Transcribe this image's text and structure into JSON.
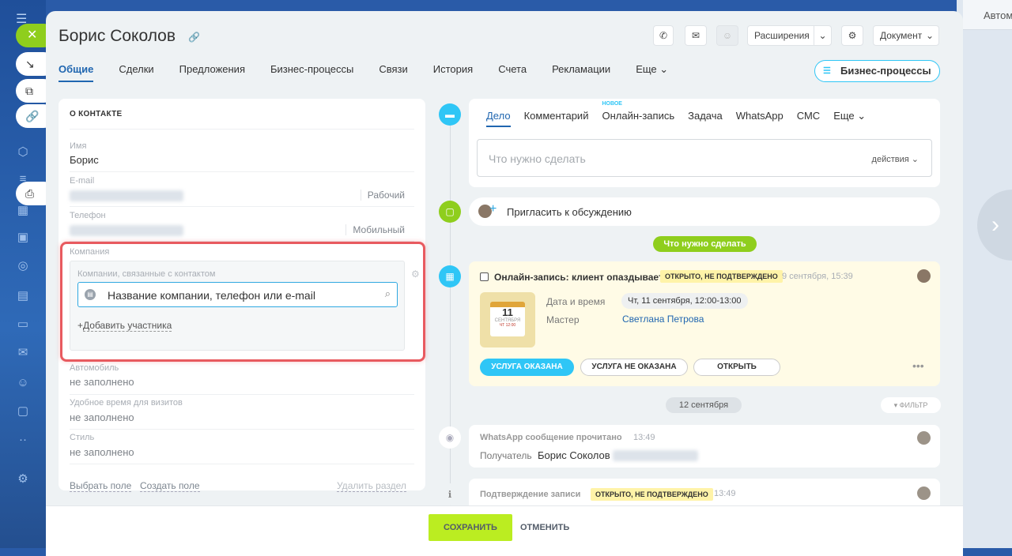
{
  "background": {
    "right_text": "Автом"
  },
  "header": {
    "title": "Борис Соколов",
    "extensions_label": "Расширения",
    "document_label": "Документ"
  },
  "tabs": [
    "Общие",
    "Сделки",
    "Предложения",
    "Бизнес-процессы",
    "Связи",
    "История",
    "Счета",
    "Рекламации",
    "Еще"
  ],
  "bp_button": "Бизнес-процессы",
  "contact": {
    "section_title": "О КОНТАКТЕ",
    "name_label": "Имя",
    "name_value": "Борис",
    "email_label": "E-mail",
    "email_type": "Рабочий",
    "phone_label": "Телефон",
    "phone_type": "Мобильный",
    "company_label": "Компания",
    "company_sub_label": "Компании, связанные с контактом",
    "company_placeholder": "Название компании, телефон или e-mail",
    "add_participant": "Добавить участника",
    "car_label": "Автомобиль",
    "car_value": "не заполнено",
    "visit_label": "Удобное время для визитов",
    "visit_value": "не заполнено",
    "style_label": "Стиль",
    "style_value": "не заполнено",
    "select_field": "Выбрать поле",
    "create_field": "Создать поле",
    "delete_section": "Удалить раздел"
  },
  "editor": {
    "tabs": [
      "Дело",
      "Комментарий",
      "Онлайн-запись",
      "Задача",
      "WhatsApp",
      "СМС",
      "Еще"
    ],
    "new_badge": "НОВОЕ",
    "placeholder": "Что нужно сделать",
    "actions": "действия"
  },
  "invite": "Пригласить к обсуждению",
  "todo_pill": "Что нужно сделать",
  "booking": {
    "title": "Онлайн-запись: клиент опаздывает",
    "status": "ОТКРЫТО, НЕ ПОДТВЕРЖДЕНО",
    "time": "9 сентября, 15:39",
    "cal_day": "11",
    "cal_month": "СЕНТЯБРЯ",
    "cal_sub": "ЧТ 12:00",
    "date_label": "Дата и время",
    "date_value": "Чт, 11 сентября, 12:00-13:00",
    "master_label": "Мастер",
    "master_value": "Светлана Петрова",
    "btn_done": "УСЛУГА ОКАЗАНА",
    "btn_not": "УСЛУГА НЕ ОКАЗАНА",
    "btn_open": "ОТКРЫТЬ"
  },
  "date_pill": "12 сентября",
  "filter": "ФИЛЬТР",
  "wa": {
    "title": "WhatsApp сообщение прочитано",
    "time": "13:49",
    "recipient_label": "Получатель",
    "recipient": "Борис Соколов"
  },
  "confirm": {
    "title": "Подтверждение записи",
    "status": "ОТКРЫТО, НЕ ПОДТВЕРЖДЕНО",
    "time": "13:49"
  },
  "footer": {
    "save": "СОХРАНИТЬ",
    "cancel": "ОТМЕНИТЬ"
  }
}
